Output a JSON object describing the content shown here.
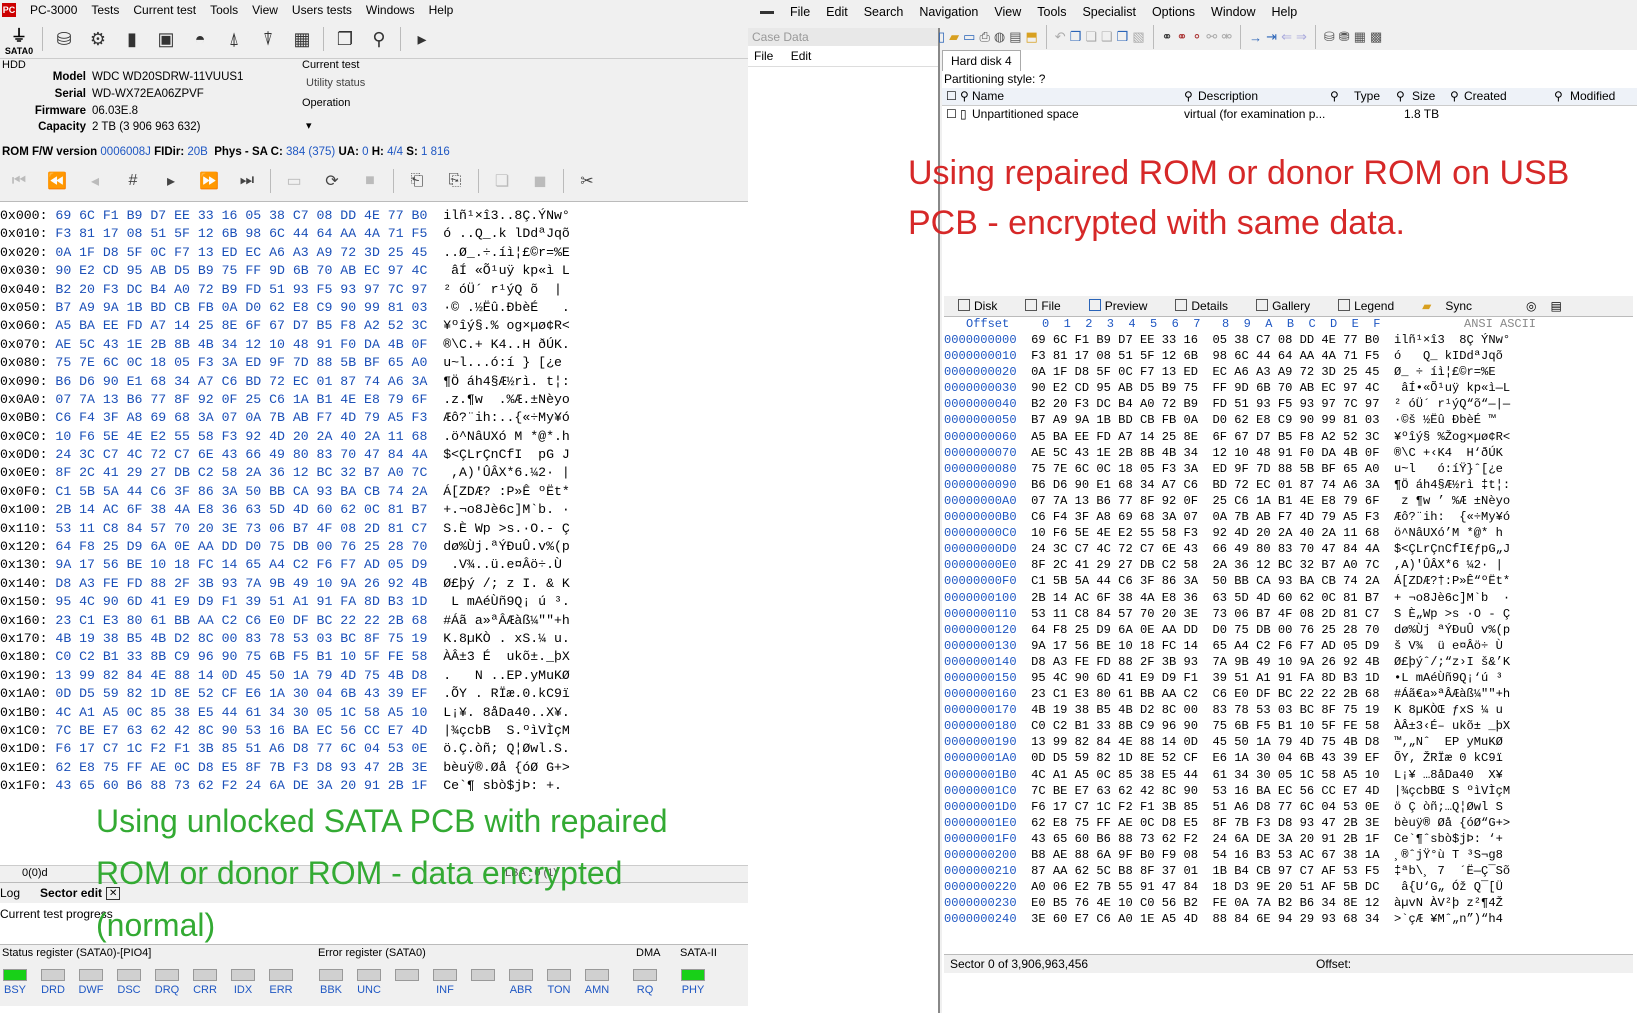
{
  "left": {
    "app_title": "PC-3000",
    "menu": [
      "Tests",
      "Current test",
      "Tools",
      "View",
      "Users tests",
      "Windows",
      "Help"
    ],
    "sata_label": "SATA0",
    "hdd_label": "HDD",
    "model_label": "Model",
    "model": "WDC WD20SDRW-11VUUS1",
    "serial_label": "Serial",
    "serial": "WD-WX72EA06ZPVF",
    "firmware_label": "Firmware",
    "firmware": "06.03E.8",
    "capacity_label": "Capacity",
    "capacity": "2 TB (3 906 963 632)",
    "current_test_label": "Current test",
    "utility_status": "Utility status",
    "operation_label": "Operation",
    "rom_line": {
      "rom_label": "ROM F/W version",
      "rom_value": "0006008J",
      "fdir_label": "FIDir:",
      "fdir_value": "20B",
      "phys_label": "Phys - SA C:",
      "phys_value": "384 (375)",
      "ua_label": "UA:",
      "ua_value": "0",
      "h_label": "H:",
      "h_value": "4/4",
      "s_label": "S:",
      "s_value": "1 816"
    },
    "hex_rows": [
      {
        "off": "0x000:",
        "bytes": "69 6C F1 B9 D7 EE 33 16 05 38 C7 08 DD 4E 77 B0",
        "asc": "ilñ¹×î3..8Ç.ÝNw°"
      },
      {
        "off": "0x010:",
        "bytes": "F3 81 17 08 51 5F 12 6B 98 6C 44 64 AA 4A 71 F5",
        "asc": "ó ..Q_.k lDdªJqõ"
      },
      {
        "off": "0x020:",
        "bytes": "0A 1F D8 5F 0C F7 13 ED EC A6 A3 A9 72 3D 25 45",
        "asc": "..Ø_.÷.íì¦£©r=%E"
      },
      {
        "off": "0x030:",
        "bytes": "90 E2 CD 95 AB D5 B9 75 FF 9D 6B 70 AB EC 97 4C",
        "asc": " âÍ «Õ¹uÿ kp«ì L"
      },
      {
        "off": "0x040:",
        "bytes": "B2 20 F3 DC B4 A0 72 B9 FD 51 93 F5 93 97 7C 97",
        "asc": "² óÜ´ r¹ýQ õ  | "
      },
      {
        "off": "0x050:",
        "bytes": "B7 A9 9A 1B BD CB FB 0A D0 62 E8 C9 90 99 81 03",
        "asc": "·© .½Ëû.ÐbèÉ   ."
      },
      {
        "off": "0x060:",
        "bytes": "A5 BA EE FD A7 14 25 8E 6F 67 D7 B5 F8 A2 52 3C",
        "asc": "¥ºîý§.% og×µø¢R<"
      },
      {
        "off": "0x070:",
        "bytes": "AE 5C 43 1E 2B 8B 4B 34 12 10 48 91 F0 DA 4B 0F",
        "asc": "®\\C.+ K4..H ðÚK."
      },
      {
        "off": "0x080:",
        "bytes": "75 7E 6C 0C 18 05 F3 3A ED 9F 7D 88 5B BF 65 A0",
        "asc": "u~l...ó:í } [¿e "
      },
      {
        "off": "0x090:",
        "bytes": "B6 D6 90 E1 68 34 A7 C6 BD 72 EC 01 87 74 A6 3A",
        "asc": "¶Ö áh4§Æ½rì. t¦:"
      },
      {
        "off": "0x0A0:",
        "bytes": "07 7A 13 B6 77 8F 92 0F 25 C6 1A B1 4E E8 79 6F",
        "asc": ".z.¶w  .%Æ.±Nèyo"
      },
      {
        "off": "0x0B0:",
        "bytes": "C6 F4 3F A8 69 68 3A 07 0A 7B AB F7 4D 79 A5 F3",
        "asc": "Æô?¨ih:..{«÷My¥ó"
      },
      {
        "off": "0x0C0:",
        "bytes": "10 F6 5E 4E E2 55 58 F3 92 4D 20 2A 40 2A 11 68",
        "asc": ".ö^NâUXó M *@*.h"
      },
      {
        "off": "0x0D0:",
        "bytes": "24 3C C7 4C 72 C7 6E 43 66 49 80 83 70 47 84 4A",
        "asc": "$<ÇLrÇnCfI  pG J"
      },
      {
        "off": "0x0E0:",
        "bytes": "8F 2C 41 29 27 DB C2 58 2A 36 12 BC 32 B7 A0 7C",
        "asc": " ,A)'ÛÂX*6.¼2· |"
      },
      {
        "off": "0x0F0:",
        "bytes": "C1 5B 5A 44 C6 3F 86 3A 50 BB CA 93 BA CB 74 2A",
        "asc": "Á[ZDÆ? :P»Ê ºËt*"
      },
      {
        "off": "0x100:",
        "bytes": "2B 14 AC 6F 38 4A E8 36 63 5D 4D 60 62 0C 81 B7",
        "asc": "+.¬o8Jè6c]M`b. ·"
      },
      {
        "off": "0x110:",
        "bytes": "53 11 C8 84 57 70 20 3E 73 06 B7 4F 08 2D 81 C7",
        "asc": "S.È Wp >s.·O.- Ç"
      },
      {
        "off": "0x120:",
        "bytes": "64 F8 25 D9 6A 0E AA DD D0 75 DB 00 76 25 28 70",
        "asc": "dø%Ùj.ªÝÐuÛ.v%(p"
      },
      {
        "off": "0x130:",
        "bytes": "9A 17 56 BE 10 18 FC 14 65 A4 C2 F6 F7 AD 05 D9",
        "asc": " .V¾..ü.e¤Âö÷­.Ù"
      },
      {
        "off": "0x140:",
        "bytes": "D8 A3 FE FD 88 2F 3B 93 7A 9B 49 10 9A 26 92 4B",
        "asc": "Ø£þý /; z I. & K"
      },
      {
        "off": "0x150:",
        "bytes": "95 4C 90 6D 41 E9 D9 F1 39 51 A1 91 FA 8D B3 1D",
        "asc": " L mAéÙñ9Q¡ ú ³."
      },
      {
        "off": "0x160:",
        "bytes": "23 C1 E3 80 61 BB AA C2 C6 E0 DF BC 22 22 2B 68",
        "asc": "#Áã a»ªÂÆàß¼\"\"+h"
      },
      {
        "off": "0x170:",
        "bytes": "4B 19 38 B5 4B D2 8C 00 83 78 53 03 BC 8F 75 19",
        "asc": "K.8µKÒ . xS.¼ u."
      },
      {
        "off": "0x180:",
        "bytes": "C0 C2 B1 33 8B C9 96 90 75 6B F5 B1 10 5F FE 58",
        "asc": "ÀÂ±3 É  ukõ±._þX"
      },
      {
        "off": "0x190:",
        "bytes": "13 99 82 84 4E 88 14 0D 45 50 1A 79 4D 75 4B D8",
        "asc": ".   N ..EP.yMuKØ"
      },
      {
        "off": "0x1A0:",
        "bytes": "0D D5 59 82 1D 8E 52 CF E6 1A 30 04 6B 43 39 EF",
        "asc": ".ÕY . RÏæ.0.kC9ï"
      },
      {
        "off": "0x1B0:",
        "bytes": "4C A1 A5 0C 85 38 E5 44 61 34 30 05 1C 58 A5 10",
        "asc": "L¡¥. 8åDa40..X¥."
      },
      {
        "off": "0x1C0:",
        "bytes": "7C BE E7 63 62 42 8C 90 53 16 BA EC 56 CC E7 4D",
        "asc": "|¾çcbB  S.ºìVÌçM"
      },
      {
        "off": "0x1D0:",
        "bytes": "F6 17 C7 1C F2 F1 3B 85 51 A6 D8 77 6C 04 53 0E",
        "asc": "ö.Ç.òñ; Q¦Øwl.S."
      },
      {
        "off": "0x1E0:",
        "bytes": "62 E8 75 FF AE 0C D8 E5 8F 7B F3 D8 93 47 2B 3E",
        "asc": "bèuÿ®.Øå {óØ G+>"
      },
      {
        "off": "0x1F0:",
        "bytes": "43 65 60 B6 88 73 62 F2 24 6A DE 3A 20 91 2B 1F",
        "asc": "Ce`¶ sbò$jÞ: +."
      }
    ],
    "caption": "Using unlocked SATA PCB with repaired ROM or donor ROM - data encrypted (normal)",
    "status_bar": "0(0)d",
    "status_lba": "LBA : 0 (1)",
    "tabs": [
      "Log",
      "Sector edit"
    ],
    "progress_label": "Current test progress",
    "status_reg_title": "Status register (SATA0)-[PIO4]",
    "error_reg_title": "Error register (SATA0)",
    "dma_title": "DMA",
    "sata2_title": "SATA-II",
    "status_regs": [
      "BSY",
      "DRD",
      "DWF",
      "DSC",
      "DRQ",
      "CRR",
      "IDX",
      "ERR"
    ],
    "error_regs": [
      "BBK",
      "UNC",
      "",
      "INF",
      "",
      "ABR",
      "TON",
      "AMN"
    ],
    "dma_regs": [
      "RQ"
    ],
    "sata_regs": [
      "PHY"
    ]
  },
  "right": {
    "menu": [
      "File",
      "Edit",
      "Search",
      "Navigation",
      "View",
      "Tools",
      "Specialist",
      "Options",
      "Window",
      "Help"
    ],
    "case_data_title": "Case Data",
    "case_menu": [
      "File",
      "Edit"
    ],
    "disk_tab": "Hard disk 4",
    "partitioning_style": "Partitioning style: ?",
    "columns": [
      "Name",
      "Description",
      "Type",
      "Size",
      "Created",
      "Modified"
    ],
    "row": {
      "name": "Unpartitioned space",
      "description": "virtual (for examination p...",
      "size": "1.8 TB"
    },
    "caption": "Using repaired ROM or donor ROM on USB PCB - encrypted with same data.",
    "view_tabs": [
      "Disk",
      "File",
      "Preview",
      "Details",
      "Gallery",
      "Legend",
      "Sync"
    ],
    "hex_header_offset": "Offset",
    "hex_header_cols": "0  1  2  3  4  5  6  7   8  9  A  B  C  D  E  F",
    "hex_header_ansi": "ANSI ASCII",
    "hex_rows": [
      {
        "off": "0000000000",
        "bytes": "69 6C F1 B9 D7 EE 33 16  05 38 C7 08 DD 4E 77 B0",
        "asc": "ilñ¹×î3  8Ç ÝNw°"
      },
      {
        "off": "0000000010",
        "bytes": "F3 81 17 08 51 5F 12 6B  98 6C 44 64 AA 4A 71 F5",
        "asc": "ó   Q_ kIDdªJqõ"
      },
      {
        "off": "0000000020",
        "bytes": "0A 1F D8 5F 0C F7 13 ED  EC A6 A3 A9 72 3D 25 45",
        "asc": "Ø_ ÷ íì¦£©r=%E"
      },
      {
        "off": "0000000030",
        "bytes": "90 E2 CD 95 AB D5 B9 75  FF 9D 6B 70 AB EC 97 4C",
        "asc": " âÍ•«Õ¹uÿ kp«ì—L"
      },
      {
        "off": "0000000040",
        "bytes": "B2 20 F3 DC B4 A0 72 B9  FD 51 93 F5 93 97 7C 97",
        "asc": "² óÜ´ r¹ýQ“õ“—|—"
      },
      {
        "off": "0000000050",
        "bytes": "B7 A9 9A 1B BD CB FB 0A  D0 62 E8 C9 90 99 81 03",
        "asc": "·©š ½Ëû ÐbèÉ ™"
      },
      {
        "off": "0000000060",
        "bytes": "A5 BA EE FD A7 14 25 8E  6F 67 D7 B5 F8 A2 52 3C",
        "asc": "¥ºîý§ %Žog×µø¢R<"
      },
      {
        "off": "0000000070",
        "bytes": "AE 5C 43 1E 2B 8B 4B 34  12 10 48 91 F0 DA 4B 0F",
        "asc": "®\\C +‹K4  H‘ðÚK"
      },
      {
        "off": "0000000080",
        "bytes": "75 7E 6C 0C 18 05 F3 3A  ED 9F 7D 88 5B BF 65 A0",
        "asc": "u~l   ó:íŸ}ˆ[¿e"
      },
      {
        "off": "0000000090",
        "bytes": "B6 D6 90 E1 68 34 A7 C6  BD 72 EC 01 87 74 A6 3A",
        "asc": "¶Ö áh4§Æ½rì ‡t¦:"
      },
      {
        "off": "00000000A0",
        "bytes": "07 7A 13 B6 77 8F 92 0F  25 C6 1A B1 4E E8 79 6F",
        "asc": " z ¶w ’ %Æ ±Nèyo"
      },
      {
        "off": "00000000B0",
        "bytes": "C6 F4 3F A8 69 68 3A 07  0A 7B AB F7 4D 79 A5 F3",
        "asc": "Æô?¨ih:  {«÷My¥ó"
      },
      {
        "off": "00000000C0",
        "bytes": "10 F6 5E 4E E2 55 58 F3  92 4D 20 2A 40 2A 11 68",
        "asc": "ö^NâUXó’M *@* h"
      },
      {
        "off": "00000000D0",
        "bytes": "24 3C C7 4C 72 C7 6E 43  66 49 80 83 70 47 84 4A",
        "asc": "$<ÇLrÇnCfI€ƒpG„J"
      },
      {
        "off": "00000000E0",
        "bytes": "8F 2C 41 29 27 DB C2 58  2A 36 12 BC 32 B7 A0 7C",
        "asc": ",A)'ÛÂX*6 ¼2· |"
      },
      {
        "off": "00000000F0",
        "bytes": "C1 5B 5A 44 C6 3F 86 3A  50 BB CA 93 BA CB 74 2A",
        "asc": "Á[ZDÆ?†:P»Ê“ºËt*"
      },
      {
        "off": "0000000100",
        "bytes": "2B 14 AC 6F 38 4A E8 36  63 5D 4D 60 62 0C 81 B7",
        "asc": "+ ¬o8Jè6c]M`b  ·"
      },
      {
        "off": "0000000110",
        "bytes": "53 11 C8 84 57 70 20 3E  73 06 B7 4F 08 2D 81 C7",
        "asc": "S È„Wp >s ·O - Ç"
      },
      {
        "off": "0000000120",
        "bytes": "64 F8 25 D9 6A 0E AA DD  D0 75 DB 00 76 25 28 70",
        "asc": "dø%Ùj ªÝÐuÛ v%(p"
      },
      {
        "off": "0000000130",
        "bytes": "9A 17 56 BE 10 18 FC 14  65 A4 C2 F6 F7 AD 05 D9",
        "asc": "š V¾  ü e¤Âö÷­ Ù"
      },
      {
        "off": "0000000140",
        "bytes": "D8 A3 FE FD 88 2F 3B 93  7A 9B 49 10 9A 26 92 4B",
        "asc": "Ø£þýˆ/;“z›I š&’K"
      },
      {
        "off": "0000000150",
        "bytes": "95 4C 90 6D 41 E9 D9 F1  39 51 A1 91 FA 8D B3 1D",
        "asc": "•L mAéÙñ9Q¡‘ú ³"
      },
      {
        "off": "0000000160",
        "bytes": "23 C1 E3 80 61 BB AA C2  C6 E0 DF BC 22 22 2B 68",
        "asc": "#Áã€a»ªÂÆàß¼\"\"+h"
      },
      {
        "off": "0000000170",
        "bytes": "4B 19 38 B5 4B D2 8C 00  83 78 53 03 BC 8F 75 19",
        "asc": "K 8µKÒŒ ƒxS ¼ u"
      },
      {
        "off": "0000000180",
        "bytes": "C0 C2 B1 33 8B C9 96 90  75 6B F5 B1 10 5F FE 58",
        "asc": "ÀÂ±3‹É– ukõ± _þX"
      },
      {
        "off": "0000000190",
        "bytes": "13 99 82 84 4E 88 14 0D  45 50 1A 79 4D 75 4B D8",
        "asc": "™‚„Nˆ  EP yMuKØ"
      },
      {
        "off": "00000001A0",
        "bytes": "0D D5 59 82 1D 8E 52 CF  E6 1A 30 04 6B 43 39 EF",
        "asc": "ÕY‚ ŽRÏæ 0 kC9ï"
      },
      {
        "off": "00000001B0",
        "bytes": "4C A1 A5 0C 85 38 E5 44  61 34 30 05 1C 58 A5 10",
        "asc": "L¡¥ …8åDa40  X¥"
      },
      {
        "off": "00000001C0",
        "bytes": "7C BE E7 63 62 42 8C 90  53 16 BA EC 56 CC E7 4D",
        "asc": "|¾çcbBŒ S ºìVÌçM"
      },
      {
        "off": "00000001D0",
        "bytes": "F6 17 C7 1C F2 F1 3B 85  51 A6 D8 77 6C 04 53 0E",
        "asc": "ö Ç òñ;…Q¦Øwl S"
      },
      {
        "off": "00000001E0",
        "bytes": "62 E8 75 FF AE 0C D8 E5  8F 7B F3 D8 93 47 2B 3E",
        "asc": "bèuÿ® Øå {óØ“G+>"
      },
      {
        "off": "00000001F0",
        "bytes": "43 65 60 B6 88 73 62 F2  24 6A DE 3A 20 91 2B 1F",
        "asc": "Ce`¶ˆsbò$jÞ: ‘+"
      },
      {
        "off": "0000000200",
        "bytes": "B8 AE 88 6A 9F B0 F9 08  54 16 B3 53 AC 67 38 1A",
        "asc": "¸®ˆjŸ°ù T ³S¬g8"
      },
      {
        "off": "0000000210",
        "bytes": "87 AA 62 5C B8 8F 37 01  1B B4 CB 97 C7 AF 53 F5",
        "asc": "‡ªb\\¸ 7  ´Ë—Ç¯Sõ"
      },
      {
        "off": "0000000220",
        "bytes": "A0 06 E2 7B 55 91 47 84  18 D3 9E 20 51 AF 5B DC",
        "asc": " â{U‘G„ Óž Q¯[Ü"
      },
      {
        "off": "0000000230",
        "bytes": "E0 B5 76 4E 10 C0 56 B2  FE 0A 7A B2 B6 34 8E 12",
        "asc": "àµvN ÀV²þ z²¶4Ž"
      },
      {
        "off": "0000000240",
        "bytes": "3E 60 E7 C6 A0 1E A5 4D  88 84 6E 94 29 93 68 34",
        "asc": ">`çÆ ¥Mˆ„n”)“h4"
      }
    ],
    "status_sector": "Sector 0 of 3,906,963,456",
    "status_offset": "Offset:"
  }
}
